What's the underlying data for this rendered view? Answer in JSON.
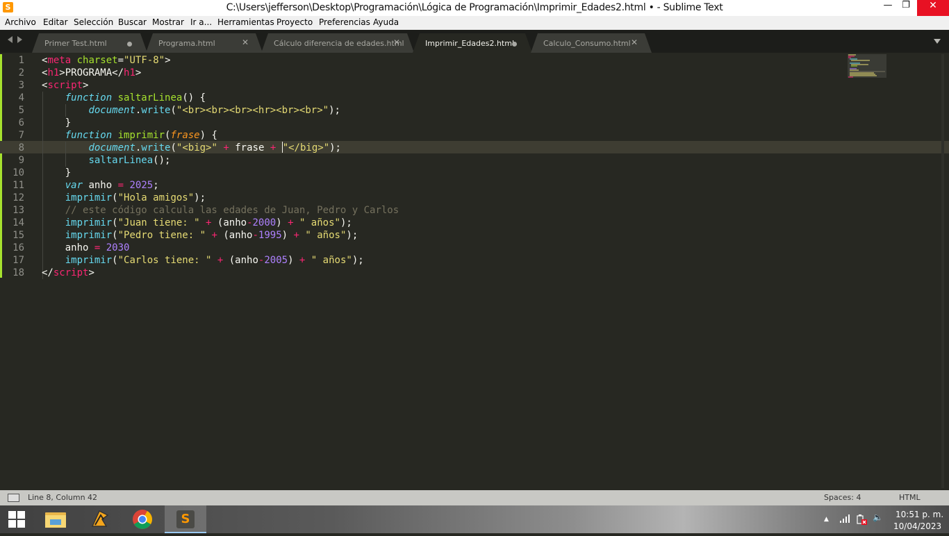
{
  "window": {
    "title": "C:\\Users\\jefferson\\Desktop\\Programación\\Lógica de Programación\\Imprimir_Edades2.html • - Sublime Text",
    "app_icon_letter": "S",
    "controls": {
      "minimize": "—",
      "maximize": "❐",
      "close": "✕"
    }
  },
  "menu": [
    "Archivo",
    "Editar",
    "Selección",
    "Buscar",
    "Mostrar",
    "Ir a...",
    "Herramientas",
    "Proyecto",
    "Preferencias",
    "Ayuda"
  ],
  "tabs": [
    {
      "label": "Primer Test.html",
      "state": "modified"
    },
    {
      "label": "Programa.html",
      "state": "close"
    },
    {
      "label": "Cálculo diferencia de edades.html",
      "state": "close"
    },
    {
      "label": "Imprimir_Edades2.html",
      "state": "modified",
      "active": true
    },
    {
      "label": "Calculo_Consumo.html",
      "state": "close"
    }
  ],
  "editor": {
    "line_numbers": [
      "1",
      "2",
      "3",
      "4",
      "5",
      "6",
      "7",
      "8",
      "9",
      "10",
      "11",
      "12",
      "13",
      "14",
      "15",
      "16",
      "17",
      "18"
    ],
    "active_line": 8,
    "code": {
      "l1": {
        "a": "<",
        "b": "meta",
        "c": " ",
        "d": "charset",
        "e": "=",
        "f": "\"UTF-8\"",
        "g": ">"
      },
      "l2": {
        "a": "<",
        "b": "h1",
        "c": ">PROGRAMA</",
        "d": "h1",
        "e": ">"
      },
      "l3": {
        "a": "<",
        "b": "script",
        "c": ">"
      },
      "l4": {
        "a": "    ",
        "b": "function",
        "c": " ",
        "d": "saltarLinea",
        "e": "() {"
      },
      "l5": {
        "a": "        ",
        "b": "document",
        "c": ".",
        "d": "write",
        "e": "(",
        "f": "\"<br><br><br><hr><br><br>\"",
        "g": ");"
      },
      "l6": {
        "a": "    }"
      },
      "l7": {
        "a": "    ",
        "b": "function",
        "c": " ",
        "d": "imprimir",
        "e": "(",
        "f": "frase",
        "g": ") {"
      },
      "l8": {
        "a": "        ",
        "b": "document",
        "c": ".",
        "d": "write",
        "e": "(",
        "f": "\"<big>\"",
        "g": " ",
        "h": "+",
        "i": " frase ",
        "j": "+",
        "k": " ",
        "l": "\"</big>\"",
        "m": ");"
      },
      "l9": {
        "a": "        ",
        "b": "saltarLinea",
        "c": "();"
      },
      "l10": {
        "a": "    }"
      },
      "l11": {
        "a": "    ",
        "b": "var",
        "c": " anho ",
        "d": "=",
        "e": " ",
        "f": "2025",
        "g": ";"
      },
      "l12": {
        "a": "    ",
        "b": "imprimir",
        "c": "(",
        "d": "\"Hola amigos\"",
        "e": ");"
      },
      "l13": {
        "a": "    ",
        "b": "// este código calcula las edades de Juan, Pedro y Carlos"
      },
      "l14": {
        "a": "    ",
        "b": "imprimir",
        "c": "(",
        "d": "\"Juan tiene: \"",
        "e": " ",
        "f": "+",
        "g": " (anho",
        "h": "-",
        "i": "2000",
        "j": ") ",
        "k": "+",
        "l": " ",
        "m": "\" años\"",
        "n": ");"
      },
      "l15": {
        "a": "    ",
        "b": "imprimir",
        "c": "(",
        "d": "\"Pedro tiene: \"",
        "e": " ",
        "f": "+",
        "g": " (anho",
        "h": "-",
        "i": "1995",
        "j": ") ",
        "k": "+",
        "l": " ",
        "m": "\" años\"",
        "n": ");"
      },
      "l16": {
        "a": "    anho ",
        "b": "=",
        "c": " ",
        "d": "2030"
      },
      "l17": {
        "a": "    ",
        "b": "imprimir",
        "c": "(",
        "d": "\"Carlos tiene: \"",
        "e": " ",
        "f": "+",
        "g": " (anho",
        "h": "-",
        "i": "2005",
        "j": ") ",
        "k": "+",
        "l": " ",
        "m": "\" años\"",
        "n": ");"
      },
      "l18": {
        "a": "</",
        "b": "script",
        "c": ">"
      }
    }
  },
  "status": {
    "position": "Line 8, Column 42",
    "spaces": "Spaces: 4",
    "syntax": "HTML"
  },
  "taskbar": {
    "apps": [
      "file-explorer",
      "winamp",
      "chrome",
      "sublime-text"
    ],
    "active_app": "sublime-text",
    "sublime_letter": "S",
    "clock_time": "10:51 p. m.",
    "clock_date": "10/04/2023",
    "tray_up": "▲",
    "volume": "🔈"
  },
  "colors": {
    "background": "#272822",
    "keyword": "#66d9ef",
    "tag": "#f92672",
    "string": "#e6db74",
    "number": "#ae81ff",
    "function": "#a6e22e",
    "param": "#fd971f",
    "comment": "#75715e",
    "close_button": "#e81123"
  }
}
